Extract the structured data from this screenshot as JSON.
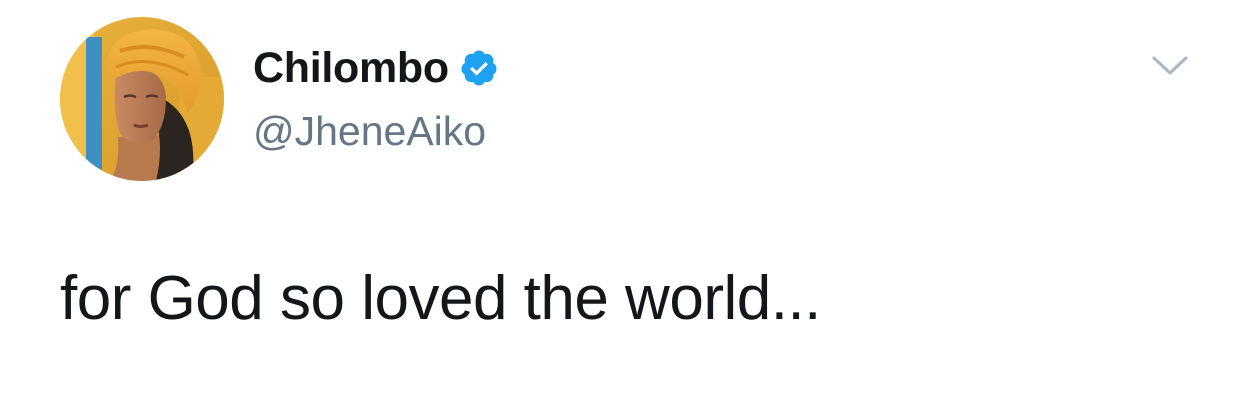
{
  "tweet": {
    "author": {
      "display_name": "Chilombo",
      "handle": "@JheneAiko",
      "verified": true,
      "avatar_icon": "profile-photo"
    },
    "text": "for God so loved the world...",
    "menu_icon": "chevron-down-icon"
  },
  "colors": {
    "name": "#14171a",
    "handle": "#657786",
    "verified_badge": "#1da1f2",
    "caret": "#aab8c2",
    "background": "#ffffff"
  }
}
